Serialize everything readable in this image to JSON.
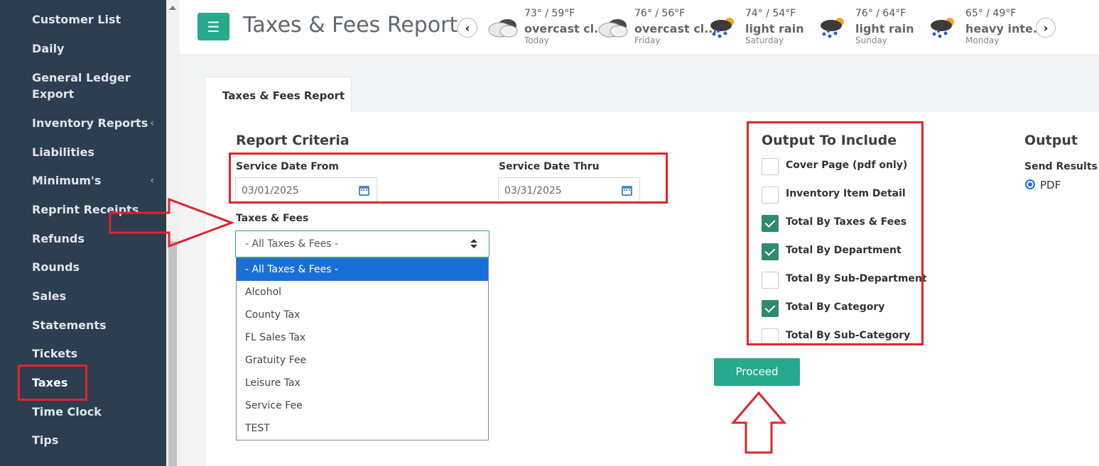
{
  "sidebar": {
    "items": [
      {
        "label": "Customer List",
        "has_chevron": false,
        "active": false
      },
      {
        "label": "Daily",
        "has_chevron": false,
        "active": false
      },
      {
        "label": "General Ledger",
        "label2": "Export",
        "has_chevron": false,
        "active": false
      },
      {
        "label": "Inventory Reports",
        "has_chevron": true,
        "active": false
      },
      {
        "label": "Liabilities",
        "has_chevron": false,
        "active": false
      },
      {
        "label": "Minimum's",
        "has_chevron": true,
        "active": false
      },
      {
        "label": "Reprint Receipts",
        "has_chevron": false,
        "active": false
      },
      {
        "label": "Refunds",
        "has_chevron": false,
        "active": false
      },
      {
        "label": "Rounds",
        "has_chevron": false,
        "active": false
      },
      {
        "label": "Sales",
        "has_chevron": false,
        "active": false
      },
      {
        "label": "Statements",
        "has_chevron": false,
        "active": false
      },
      {
        "label": "Tickets",
        "has_chevron": false,
        "active": false
      },
      {
        "label": "Taxes",
        "has_chevron": false,
        "active": true
      },
      {
        "label": "Time Clock",
        "has_chevron": false,
        "active": false
      },
      {
        "label": "Tips",
        "has_chevron": false,
        "active": false
      }
    ],
    "chevron_glyph": "‹"
  },
  "header": {
    "menu_icon": "☰",
    "title": "Taxes & Fees Report",
    "prev_glyph": "‹",
    "next_glyph": "›",
    "weather": [
      {
        "temp": "73° / 59°F",
        "desc": "overcast cl...",
        "day": "Today",
        "icon": "overcast-cloud-icon"
      },
      {
        "temp": "76° / 56°F",
        "desc": "overcast cl...",
        "day": "Friday",
        "icon": "overcast-cloud-icon"
      },
      {
        "temp": "74° / 54°F",
        "desc": "light rain",
        "day": "Saturday",
        "icon": "sun-rain-cloud-icon"
      },
      {
        "temp": "76° / 64°F",
        "desc": "light rain",
        "day": "Sunday",
        "icon": "sun-rain-cloud-icon"
      },
      {
        "temp": "65° / 49°F",
        "desc": "heavy inte...",
        "day": "Monday",
        "icon": "sun-rain-cloud-icon"
      }
    ]
  },
  "tab": {
    "label": "Taxes & Fees Report"
  },
  "criteria": {
    "title": "Report Criteria",
    "date_from_label": "Service Date From",
    "date_from_value": "03/01/2025",
    "date_thru_label": "Service Date Thru",
    "date_thru_value": "03/31/2025",
    "taxes_label": "Taxes & Fees",
    "taxes_selected": "- All Taxes & Fees -",
    "taxes_options": [
      "- All Taxes & Fees -",
      "Alcohol",
      "County Tax",
      "FL Sales Tax",
      "Gratuity Fee",
      "Leisure Tax",
      "Service Fee",
      "TEST"
    ]
  },
  "output_include": {
    "title": "Output To Include",
    "options": [
      {
        "label": "Cover Page (pdf only)",
        "checked": false
      },
      {
        "label": "Inventory Item Detail",
        "checked": false
      },
      {
        "label": "Total By Taxes & Fees",
        "checked": true
      },
      {
        "label": "Total By Department",
        "checked": true
      },
      {
        "label": "Total By Sub-Department",
        "checked": false
      },
      {
        "label": "Total By Category",
        "checked": true
      },
      {
        "label": "Total By Sub-Category",
        "checked": false
      }
    ]
  },
  "output": {
    "title": "Output",
    "send_label": "Send Results T",
    "radio_label": "PDF"
  },
  "proceed_label": "Proceed",
  "colors": {
    "sidebar_bg": "#2c3e50",
    "accent": "#26a98c",
    "annotation_red": "#e1232b",
    "selected_option": "#1a6fd6"
  }
}
